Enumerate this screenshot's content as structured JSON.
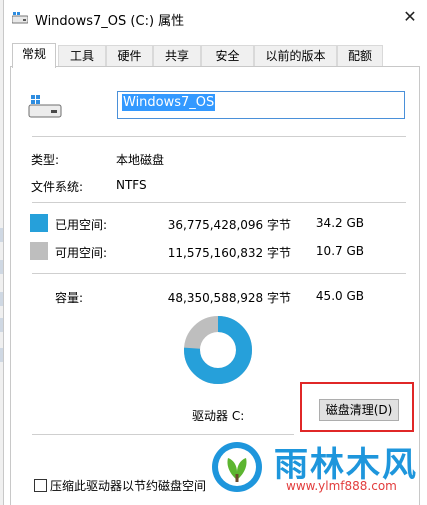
{
  "window": {
    "title": "Windows7_OS (C:) 属性",
    "close_glyph": "✕"
  },
  "tabs": [
    {
      "label": "常规",
      "active": true
    },
    {
      "label": "工具"
    },
    {
      "label": "硬件"
    },
    {
      "label": "共享"
    },
    {
      "label": "安全"
    },
    {
      "label": "以前的版本"
    },
    {
      "label": "配额"
    }
  ],
  "general": {
    "drive_name": "Windows7_OS",
    "type_label": "类型:",
    "type_value": "本地磁盘",
    "fs_label": "文件系统:",
    "fs_value": "NTFS",
    "used": {
      "label": "已用空间:",
      "bytes": "36,775,428,096 字节",
      "size": "34.2 GB",
      "color": "#26a0da"
    },
    "free": {
      "label": "可用空间:",
      "bytes": "11,575,160,832 字节",
      "size": "10.7 GB",
      "color": "#bebebe"
    },
    "capacity": {
      "label": "容量:",
      "bytes": "48,350,588,928 字节",
      "size": "45.0 GB"
    },
    "used_fraction": 0.76,
    "drive_label": "驱动器 C:",
    "cleanup_button": "磁盘清理(D)",
    "compress_checkbox": "压缩此驱动器以节约磁盘空间",
    "compress_checked": false
  },
  "watermark": {
    "brand": "雨林木风",
    "url": "www.ylmf888.com"
  }
}
